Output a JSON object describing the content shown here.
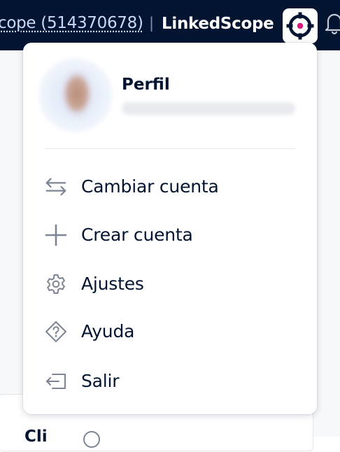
{
  "topbar": {
    "account_link": "cope (514370678)",
    "separator": "|",
    "brand": "LinkedScope",
    "logo_icon": "crosshair-target-icon",
    "notification_icon": "bell-icon"
  },
  "menu": {
    "profile": {
      "title": "Perfil"
    },
    "items": [
      {
        "label": "Cambiar cuenta",
        "icon": "switch-arrows-icon"
      },
      {
        "label": "Crear cuenta",
        "icon": "plus-icon"
      },
      {
        "label": "Ajustes",
        "icon": "gear-icon"
      },
      {
        "label": "Ayuda",
        "icon": "help-diamond-icon"
      },
      {
        "label": "Salir",
        "icon": "logout-icon"
      }
    ]
  },
  "content": {
    "partial_heading": "Cli"
  },
  "colors": {
    "navbar": "#031431",
    "brand_accent": "#e0177a",
    "text": "#031431",
    "link": "#c9d9f6"
  }
}
